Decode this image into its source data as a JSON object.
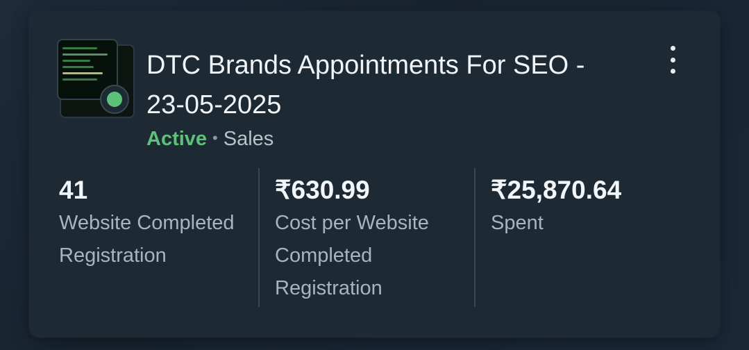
{
  "campaign": {
    "title": "DTC Brands Appointments For SEO - 23-05-2025",
    "status": "Active",
    "separator": "•",
    "category": "Sales",
    "status_color": "#5cc27a"
  },
  "icons": {
    "menu": "more-vertical-icon",
    "status": "active-status-dot-icon"
  },
  "stats": [
    {
      "value": "41",
      "label": "Website Completed Registration"
    },
    {
      "value": "₹630.99",
      "label": "Cost per Website Completed Registration"
    },
    {
      "value": "₹25,870.64",
      "label": "Spent"
    }
  ]
}
